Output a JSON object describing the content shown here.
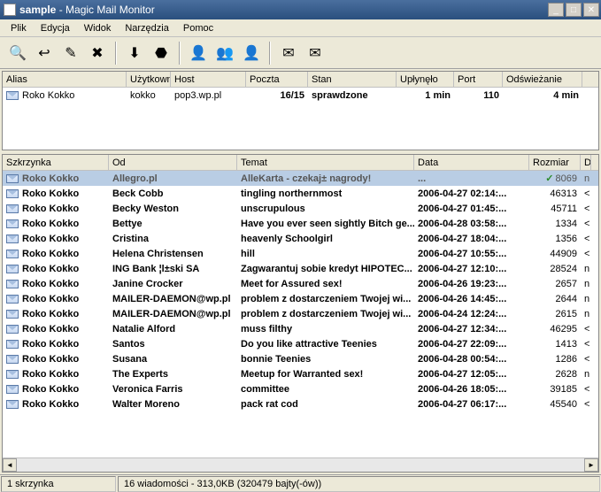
{
  "window": {
    "title_strong": "sample",
    "title_rest": " - Magic Mail Monitor"
  },
  "menu": [
    "Plik",
    "Edycja",
    "Widok",
    "Narzędzia",
    "Pomoc"
  ],
  "toolbar": [
    {
      "name": "search-icon",
      "glyph": "🔍"
    },
    {
      "name": "reply-icon",
      "glyph": "↩"
    },
    {
      "name": "compose-icon",
      "glyph": "✎"
    },
    {
      "name": "delete-icon",
      "glyph": "✖"
    },
    {
      "sep": true
    },
    {
      "name": "download-icon",
      "glyph": "⬇"
    },
    {
      "name": "stop-icon",
      "glyph": "⬣"
    },
    {
      "sep": true
    },
    {
      "name": "account-ok-icon",
      "glyph": "👤"
    },
    {
      "name": "account-add-icon",
      "glyph": "👥"
    },
    {
      "name": "account-del-icon",
      "glyph": "👤"
    },
    {
      "sep": true
    },
    {
      "name": "mail-icon",
      "glyph": "✉"
    },
    {
      "name": "mail-del-icon",
      "glyph": "✉"
    }
  ],
  "accounts": {
    "headers": [
      "Alias",
      "Użytkownik",
      "Host",
      "Poczta",
      "Stan",
      "Upłynęło",
      "Port",
      "Odświeżanie"
    ],
    "rows": [
      {
        "alias": "Roko Kokko",
        "user": "kokko",
        "host": "pop3.wp.pl",
        "mail": "16/15",
        "state": "sprawdzone",
        "elapsed": "1 min",
        "port": "110",
        "refresh": "4 min"
      }
    ]
  },
  "messages": {
    "headers": [
      "Szkrzynka",
      "Od",
      "Temat",
      "Data",
      "Rozmiar",
      "D"
    ],
    "rows": [
      {
        "sel": true,
        "box": "Roko Kokko",
        "from": "Allegro.pl",
        "subj": "AlleKarta - czekaj± nagrody!",
        "date": "...",
        "size": "8069",
        "d": "n",
        "chk": true
      },
      {
        "box": "Roko Kokko",
        "from": "Beck Cobb",
        "subj": "tingling northernmost",
        "date": "2006-04-27 02:14:...",
        "size": "46313",
        "d": "<"
      },
      {
        "box": "Roko Kokko",
        "from": "Becky Weston",
        "subj": "unscrupulous",
        "date": "2006-04-27 01:45:...",
        "size": "45711",
        "d": "<"
      },
      {
        "box": "Roko Kokko",
        "from": "Bettye",
        "subj": "Have you ever seen sightly Bitch ge...",
        "date": "2006-04-28 03:58:...",
        "size": "1334",
        "d": "<"
      },
      {
        "box": "Roko Kokko",
        "from": "Cristina",
        "subj": "heavenly Schoolgirl",
        "date": "2006-04-27 18:04:...",
        "size": "1356",
        "d": "<"
      },
      {
        "box": "Roko Kokko",
        "from": "Helena Christensen",
        "subj": "hill",
        "date": "2006-04-27 10:55:...",
        "size": "44909",
        "d": "<"
      },
      {
        "box": "Roko Kokko",
        "from": "ING Bank ¦l±ski SA",
        "subj": "Zagwarantuj sobie kredyt HIPOTEC...",
        "date": "2006-04-27 12:10:...",
        "size": "28524",
        "d": "n"
      },
      {
        "box": "Roko Kokko",
        "from": "Janine Crocker",
        "subj": "Meet for Assured sex!",
        "date": "2006-04-26 19:23:...",
        "size": "2657",
        "d": "n"
      },
      {
        "box": "Roko Kokko",
        "from": "MAILER-DAEMON@wp.pl",
        "subj": "problem z dostarczeniem Twojej wi...",
        "date": "2006-04-26 14:45:...",
        "size": "2644",
        "d": "n"
      },
      {
        "box": "Roko Kokko",
        "from": "MAILER-DAEMON@wp.pl",
        "subj": "problem z dostarczeniem Twojej wi...",
        "date": "2006-04-24 12:24:...",
        "size": "2615",
        "d": "n"
      },
      {
        "box": "Roko Kokko",
        "from": "Natalie Alford",
        "subj": "muss filthy",
        "date": "2006-04-27 12:34:...",
        "size": "46295",
        "d": "<"
      },
      {
        "box": "Roko Kokko",
        "from": "Santos",
        "subj": "Do you like attractive Teenies",
        "date": "2006-04-27 22:09:...",
        "size": "1413",
        "d": "<"
      },
      {
        "box": "Roko Kokko",
        "from": "Susana",
        "subj": "bonnie Teenies",
        "date": "2006-04-28 00:54:...",
        "size": "1286",
        "d": "<"
      },
      {
        "box": "Roko Kokko",
        "from": "The Experts",
        "subj": "Meetup for Warranted sex!",
        "date": "2006-04-27 12:05:...",
        "size": "2628",
        "d": "n"
      },
      {
        "box": "Roko Kokko",
        "from": "Veronica Farris",
        "subj": "committee",
        "date": "2006-04-26 18:05:...",
        "size": "39185",
        "d": "<"
      },
      {
        "box": "Roko Kokko",
        "from": "Walter Moreno",
        "subj": "pack rat cod",
        "date": "2006-04-27 06:17:...",
        "size": "45540",
        "d": "<"
      }
    ]
  },
  "status": {
    "left": "1 skrzynka",
    "right": "16 wiadomości - 313,0KB (320479 bajty(-ów))"
  }
}
